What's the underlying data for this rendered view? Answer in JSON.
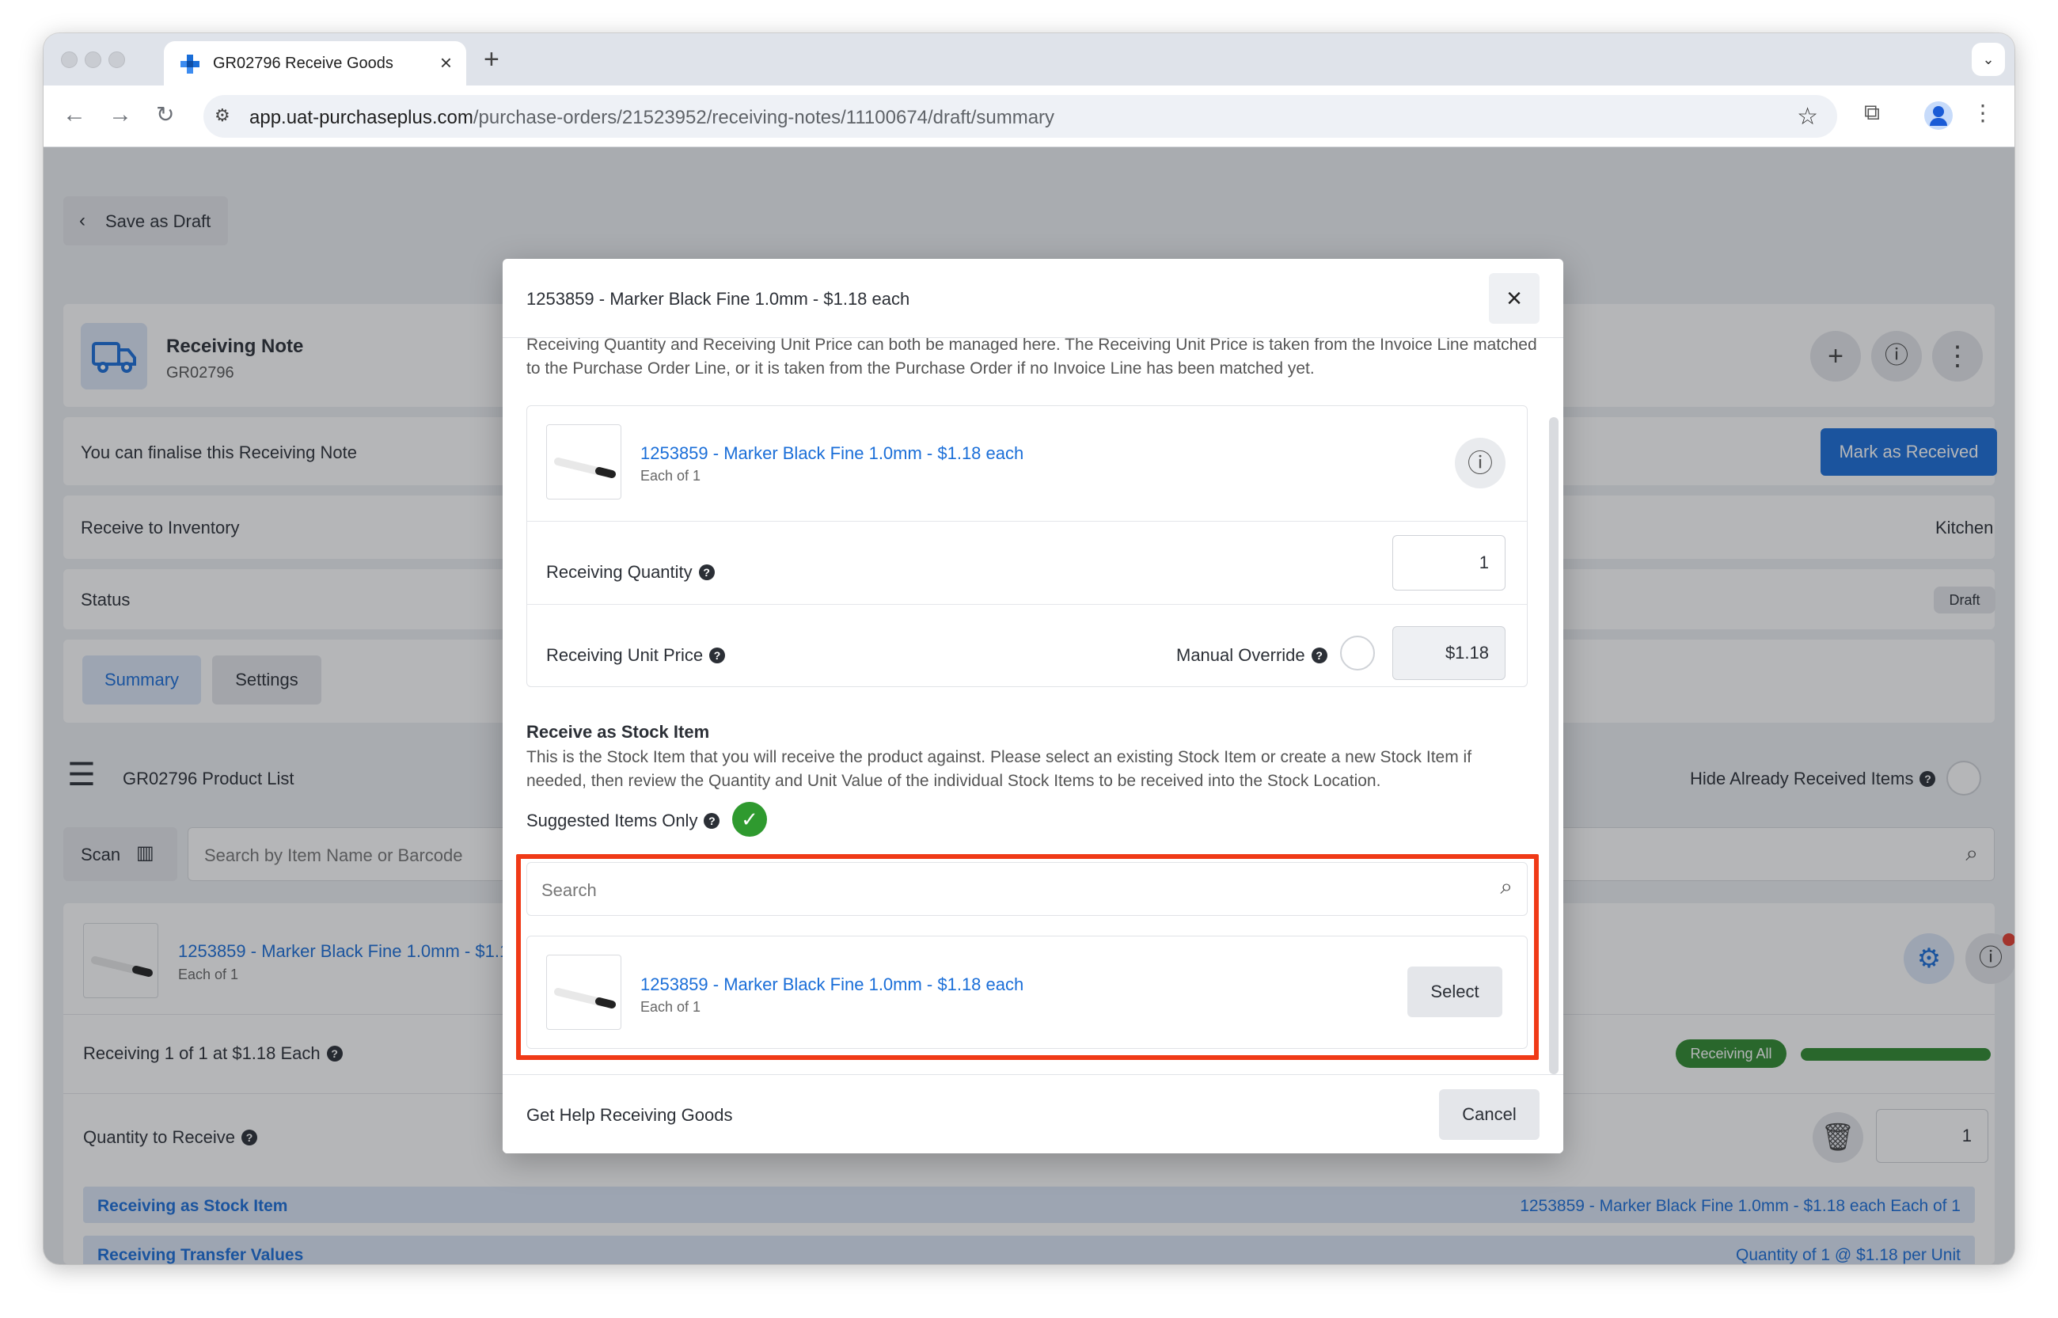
{
  "browser": {
    "tab_title": "GR02796 Receive Goods",
    "url_host": "app.uat-purchaseplus.com",
    "url_path": "/purchase-orders/21523952/receiving-notes/11100674/draft/summary"
  },
  "page": {
    "save_draft_label": "Save as Draft",
    "note_title": "Receiving Note",
    "note_id": "GR02796",
    "finalise_text": "You can finalise this Receiving Note",
    "mark_received_label": "Mark as Received",
    "inventory_label": "Receive to Inventory",
    "inventory_value": "Kitchen",
    "status_label": "Status",
    "status_value": "Draft",
    "tabs": [
      "Summary",
      "Settings"
    ],
    "product_list_title": "GR02796 Product List",
    "hide_received_label": "Hide Already Received Items",
    "scan_label": "Scan",
    "search_placeholder": "Search by Item Name or Barcode",
    "item_name": "1253859 - Marker Black Fine 1.0mm - $1.18",
    "item_sub": "Each of 1",
    "receiving_summary": "Receiving 1 of 1 at $1.18 Each",
    "receiving_all_badge": "Receiving All",
    "qty_to_receive_label": "Quantity to Receive",
    "qty_to_receive_value": "1",
    "receiving_stock_label": "Receiving as Stock Item",
    "receiving_stock_value": "1253859 - Marker Black Fine 1.0mm - $1.18 each Each of 1",
    "transfer_label": "Receiving Transfer Values",
    "transfer_value": "Quantity of 1 @ $1.18 per Unit"
  },
  "modal": {
    "title": "1253859 - Marker Black Fine 1.0mm - $1.18 each",
    "intro": "Receiving Quantity and Receiving Unit Price can both be managed here. The Receiving Unit Price is taken from the Invoice Line matched to the Purchase Order Line, or it is taken from the Purchase Order if no Invoice Line has been matched yet.",
    "product_name": "1253859 - Marker Black Fine 1.0mm - $1.18 each",
    "product_sub": "Each of 1",
    "qty_label": "Receiving Quantity",
    "qty_value": "1",
    "price_label": "Receiving Unit Price",
    "override_label": "Manual Override",
    "price_value": "$1.18",
    "stock_heading": "Receive as Stock Item",
    "stock_desc": "This is the Stock Item that you will receive the product against. Please select an existing Stock Item or create a new Stock Item if needed, then review the Quantity and Unit Value of the individual Stock Items to be received into the Stock Location.",
    "suggested_label": "Suggested Items Only",
    "search_placeholder": "Search",
    "result_name": "1253859 - Marker Black Fine 1.0mm - $1.18 each",
    "result_sub": "Each of 1",
    "select_label": "Select",
    "help_link": "Get Help Receiving Goods",
    "cancel_label": "Cancel"
  }
}
